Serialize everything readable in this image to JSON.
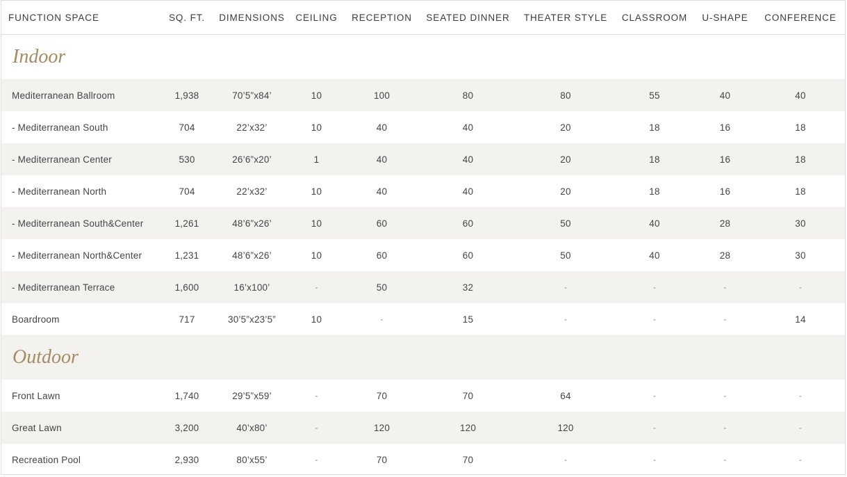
{
  "headers": {
    "function_space": "FUNCTION SPACE",
    "sqft": "SQ. FT.",
    "dimensions": "DIMENSIONS",
    "ceiling": "CEILING",
    "reception": "RECEPTION",
    "seated_dinner": "SEATED DINNER",
    "theater": "THEATER STYLE",
    "classroom": "CLASSROOM",
    "ushape": "U-SHAPE",
    "conference": "CONFERENCE"
  },
  "indoor": {
    "title": "Indoor",
    "rows": [
      {
        "name": "Mediterranean Ballroom",
        "sqft": "1,938",
        "dim": "70’5”x84’",
        "ceiling": "10",
        "reception": "100",
        "dinner": "80",
        "theater": "80",
        "classroom": "55",
        "ushape": "40",
        "conference": "40"
      },
      {
        "name": "- Mediterranean South",
        "sqft": "704",
        "dim": "22’x32’",
        "ceiling": "10",
        "reception": "40",
        "dinner": "40",
        "theater": "20",
        "classroom": "18",
        "ushape": "16",
        "conference": "18"
      },
      {
        "name": "- Mediterranean Center",
        "sqft": "530",
        "dim": "26’6”x20’",
        "ceiling": "1",
        "reception": "40",
        "dinner": "40",
        "theater": "20",
        "classroom": "18",
        "ushape": "16",
        "conference": "18"
      },
      {
        "name": "- Mediterranean North",
        "sqft": "704",
        "dim": "22’x32’",
        "ceiling": "10",
        "reception": "40",
        "dinner": "40",
        "theater": "20",
        "classroom": "18",
        "ushape": "16",
        "conference": "18"
      },
      {
        "name": "- Mediterranean South&Center",
        "sqft": "1,261",
        "dim": "48’6”x26’",
        "ceiling": "10",
        "reception": "60",
        "dinner": "60",
        "theater": "50",
        "classroom": "40",
        "ushape": "28",
        "conference": "30"
      },
      {
        "name": "- Mediterranean North&Center",
        "sqft": "1,231",
        "dim": "48’6”x26’",
        "ceiling": "10",
        "reception": "60",
        "dinner": "60",
        "theater": "50",
        "classroom": "40",
        "ushape": "28",
        "conference": "30"
      },
      {
        "name": "- Mediterranean Terrace",
        "sqft": "1,600",
        "dim": "16’x100’",
        "ceiling": "-",
        "reception": "50",
        "dinner": "32",
        "theater": "-",
        "classroom": "-",
        "ushape": "-",
        "conference": "-"
      },
      {
        "name": "Boardroom",
        "sqft": "717",
        "dim": "30’5”x23’5”",
        "ceiling": "10",
        "reception": "-",
        "dinner": "15",
        "theater": "-",
        "classroom": "-",
        "ushape": "-",
        "conference": "14"
      }
    ]
  },
  "outdoor": {
    "title": "Outdoor",
    "rows": [
      {
        "name": "Front Lawn",
        "sqft": "1,740",
        "dim": "29’5”x59’",
        "ceiling": "-",
        "reception": "70",
        "dinner": "70",
        "theater": "64",
        "classroom": "-",
        "ushape": "-",
        "conference": "-"
      },
      {
        "name": "Great Lawn",
        "sqft": "3,200",
        "dim": "40’x80’",
        "ceiling": "-",
        "reception": "120",
        "dinner": "120",
        "theater": "120",
        "classroom": "-",
        "ushape": "-",
        "conference": "-"
      },
      {
        "name": "Recreation Pool",
        "sqft": "2,930",
        "dim": "80’x55’",
        "ceiling": "-",
        "reception": "70",
        "dinner": "70",
        "theater": "-",
        "classroom": "-",
        "ushape": "-",
        "conference": "-"
      }
    ]
  },
  "colors": {
    "section_title": "#a38b62",
    "row_shade": "#f4f2ef",
    "border": "#dcdcdc"
  }
}
